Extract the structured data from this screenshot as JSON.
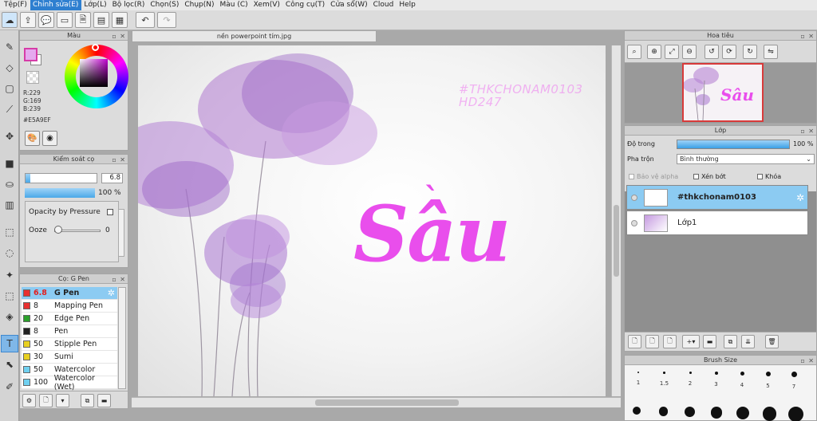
{
  "menu": [
    "Tệp(F)",
    "Chỉnh sửa(E)",
    "Lớp(L)",
    "Bộ lọc(R)",
    "Chọn(S)",
    "Chụp(N)",
    "Màu (C)",
    "Xem(V)",
    "Công cụ(T)",
    "Cửa sổ(W)",
    "Cloud",
    "Help"
  ],
  "menu_active_index": 1,
  "color_panel": {
    "title": "Màu",
    "r": "R:229",
    "g": "G:169",
    "b": "B:239",
    "hex": "#E5A9EF",
    "main_color": "#E5A9EF"
  },
  "brush_control": {
    "title": "Kiểm soát cọ",
    "size_value": "6.8",
    "opacity_value": "100 %",
    "opacity_fraction": 1.0,
    "size_fraction": 0.07,
    "pressure_label": "Opacity by Pressure",
    "ooze_label": "Ooze",
    "ooze_value": "0"
  },
  "brush_list": {
    "title": "Cọ: G Pen",
    "items": [
      {
        "size": "6.8",
        "name": "G Pen",
        "color": "#e83030",
        "selected": true
      },
      {
        "size": "8",
        "name": "Mapping Pen",
        "color": "#e83030",
        "selected": false
      },
      {
        "size": "20",
        "name": "Edge Pen",
        "color": "#2aa02a",
        "selected": false
      },
      {
        "size": "8",
        "name": "Pen",
        "color": "#222222",
        "selected": false
      },
      {
        "size": "50",
        "name": "Stipple Pen",
        "color": "#e8d020",
        "selected": false
      },
      {
        "size": "30",
        "name": "Sumi",
        "color": "#e8d020",
        "selected": false
      },
      {
        "size": "50",
        "name": "Watercolor",
        "color": "#6fd0f0",
        "selected": false
      },
      {
        "size": "100",
        "name": "Watercolor (Wet)",
        "color": "#6fd0f0",
        "selected": false
      }
    ]
  },
  "document": {
    "tab_title": "nền powerpoint tím.jpg",
    "hashtag_line1": "#THKCHONAM0103",
    "hashtag_line2": "HD247",
    "main_text_base": "Sâu",
    "main_text_accent": "`"
  },
  "navigator": {
    "title": "Hoa tiêu"
  },
  "layers": {
    "title": "Lớp",
    "opacity_label": "Độ trong",
    "opacity_value": "100 %",
    "blend_label": "Pha trộn",
    "blend_value": "Bình thường",
    "protect_alpha": "Bảo vệ alpha",
    "clipping": "Xén bớt",
    "lock": "Khóa",
    "items": [
      {
        "name": "#thkchonam0103",
        "selected": true
      },
      {
        "name": "Lớp1",
        "selected": false
      }
    ]
  },
  "brush_size": {
    "title": "Brush Size",
    "sizes": [
      "1",
      "1.5",
      "2",
      "3",
      "4",
      "5",
      "7"
    ]
  },
  "colors": {
    "accent": "#2e7fd0",
    "selection": "#8ccbf2",
    "text_magenta": "#e94eec"
  }
}
